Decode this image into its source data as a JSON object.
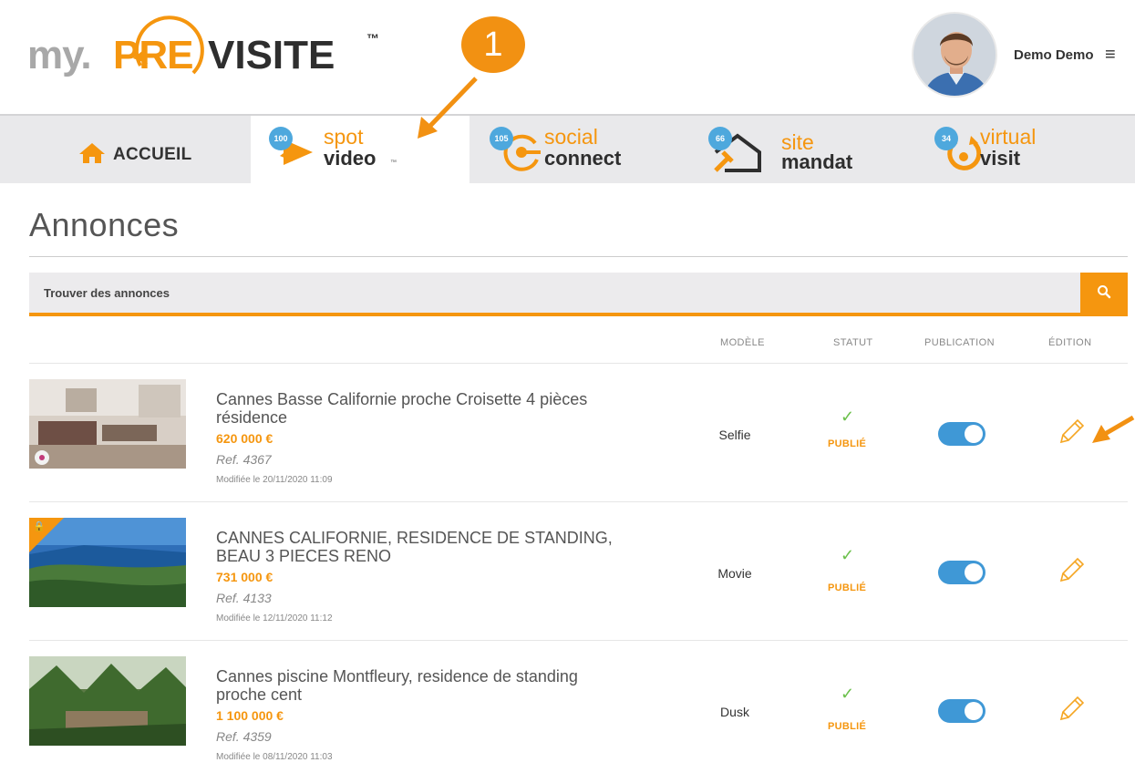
{
  "header": {
    "logo": {
      "part1": "my.",
      "part2": "PRE",
      "part3": "VISITE",
      "tm": "™"
    },
    "user_name": "Demo Demo",
    "menu_icon": "hamburger-icon"
  },
  "annotation": {
    "number": "1"
  },
  "tabs": [
    {
      "label": "ACCUEIL",
      "icon": "home-icon"
    },
    {
      "count": "100",
      "line1": "spot",
      "line2": "video",
      "tm": "™"
    },
    {
      "count": "105",
      "line1": "social",
      "line2": "connect"
    },
    {
      "count": "66",
      "line1": "site",
      "line2": "mandat"
    },
    {
      "count": "34",
      "line1": "virtual",
      "line2": "visit"
    }
  ],
  "page": {
    "title": "Annonces"
  },
  "search": {
    "placeholder": "Trouver des annonces",
    "icon": "search-icon"
  },
  "table": {
    "columns": {
      "model": "MODÈLE",
      "status": "STATUT",
      "publication": "PUBLICATION",
      "edition": "ÉDITION"
    },
    "rows": [
      {
        "title_line1": "Cannes Basse Californie proche Croisette 4 pièces",
        "title_line2": "résidence",
        "price": "620 000 €",
        "ref": "Ref. 4367",
        "modified": "Modifiée le 20/11/2020 11:09",
        "model": "Selfie",
        "check": "✓",
        "status": "PUBLIÉ",
        "published": true,
        "locked": false
      },
      {
        "title_line1": "CANNES CALIFORNIE, RESIDENCE DE STANDING,",
        "title_line2": "BEAU 3 PIECES RENO",
        "price": "731 000 €",
        "ref": "Ref. 4133",
        "modified": "Modifiée le 12/11/2020 11:12",
        "model": "Movie",
        "check": "✓",
        "status": "PUBLIÉ",
        "published": true,
        "locked": true
      },
      {
        "title_line1": "Cannes piscine Montfleury, residence de standing",
        "title_line2": "proche cent",
        "price": "1 100 000 €",
        "ref": "Ref. 4359",
        "modified": "Modifiée le 08/11/2020 11:03",
        "model": "Dusk",
        "check": "✓",
        "status": "PUBLIÉ",
        "published": true,
        "locked": false
      }
    ]
  },
  "colors": {
    "accent": "#f5960f",
    "toggle": "#3f98d6",
    "badge": "#4ea8dd",
    "check": "#6bc04b"
  }
}
